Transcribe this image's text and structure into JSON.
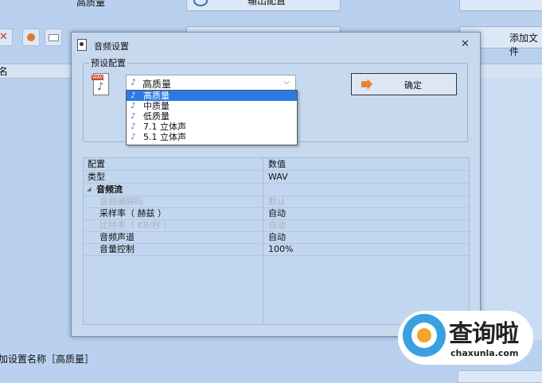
{
  "background": {
    "top_label": "高质量",
    "output_button": "输出配置",
    "add_file_button": "添加文件",
    "column_name": "名",
    "bottom_status": "加设置名称［高质量］"
  },
  "dialog": {
    "title": "音频设置",
    "group_label": "预设配置",
    "icon_tag": "WAV",
    "combo_value": "高质量",
    "options": [
      "高质量",
      "中质量",
      "低质量",
      "7.1 立体声",
      "5.1 立体声"
    ],
    "ok_button": "确定",
    "table": {
      "header": {
        "key": "配置",
        "value": "数值"
      },
      "rows": [
        {
          "key": "类型",
          "value": "WAV"
        },
        {
          "key": "音频流",
          "value": ""
        },
        {
          "key": "音频编解码",
          "value": "默认"
        },
        {
          "key": "采样率（ 赫兹 ）",
          "value": "自动"
        },
        {
          "key": "比特率（ KB/秒 ）",
          "value": "自动"
        },
        {
          "key": "音频声道",
          "value": "自动"
        },
        {
          "key": "音量控制",
          "value": "100%"
        }
      ]
    }
  },
  "watermark": {
    "brand": "查询啦",
    "url": "chaxunla.com"
  },
  "colors": {
    "selection": "#2c7be5",
    "background": "#b9d1ee",
    "dialog": "#c7d9ef"
  }
}
